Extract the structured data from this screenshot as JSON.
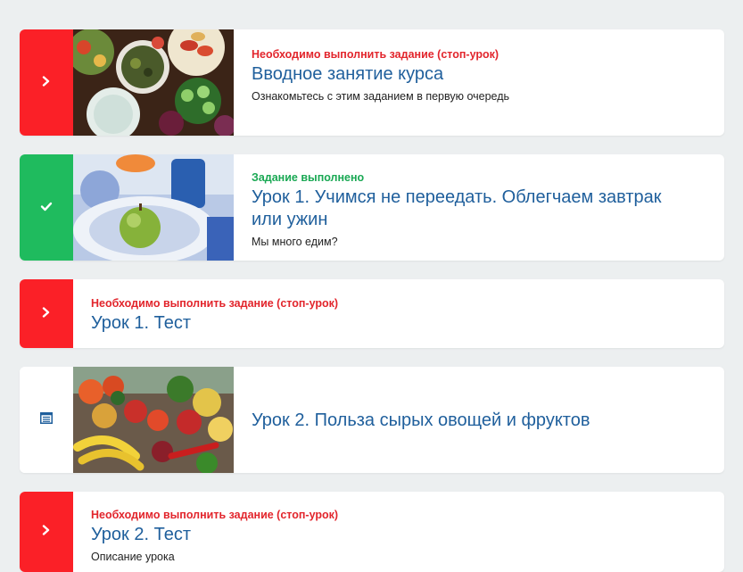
{
  "lessons": [
    {
      "status": "Необходимо выполнить задание (стоп-урок)",
      "title": "Вводное занятие курса",
      "description": "Ознакомьтесь с этим заданием в первую очередь",
      "indicator_icon": "chevron-right-icon",
      "indicator_color": "#fb2027",
      "image": "food-salads-photo"
    },
    {
      "status": "Задание выполнено",
      "title": "Урок 1. Учимся не переедать. Облегчаем завтрак или ужин",
      "description": "Мы много едим?",
      "indicator_icon": "check-icon",
      "indicator_color": "#1fbb5e",
      "image": "apple-on-plate-photo"
    },
    {
      "status": "Необходимо выполнить задание (стоп-урок)",
      "title": "Урок 1. Тест",
      "indicator_icon": "chevron-right-icon",
      "indicator_color": "#fb2027"
    },
    {
      "title": "Урок 2. Польза сырых овощей и фруктов",
      "indicator_icon": "document-list-icon",
      "image": "fruits-vegetables-photo"
    },
    {
      "status": "Необходимо выполнить задание (стоп-урок)",
      "title": "Урок 2. Тест",
      "description": "Описание урока",
      "indicator_icon": "chevron-right-icon",
      "indicator_color": "#fb2027"
    }
  ]
}
